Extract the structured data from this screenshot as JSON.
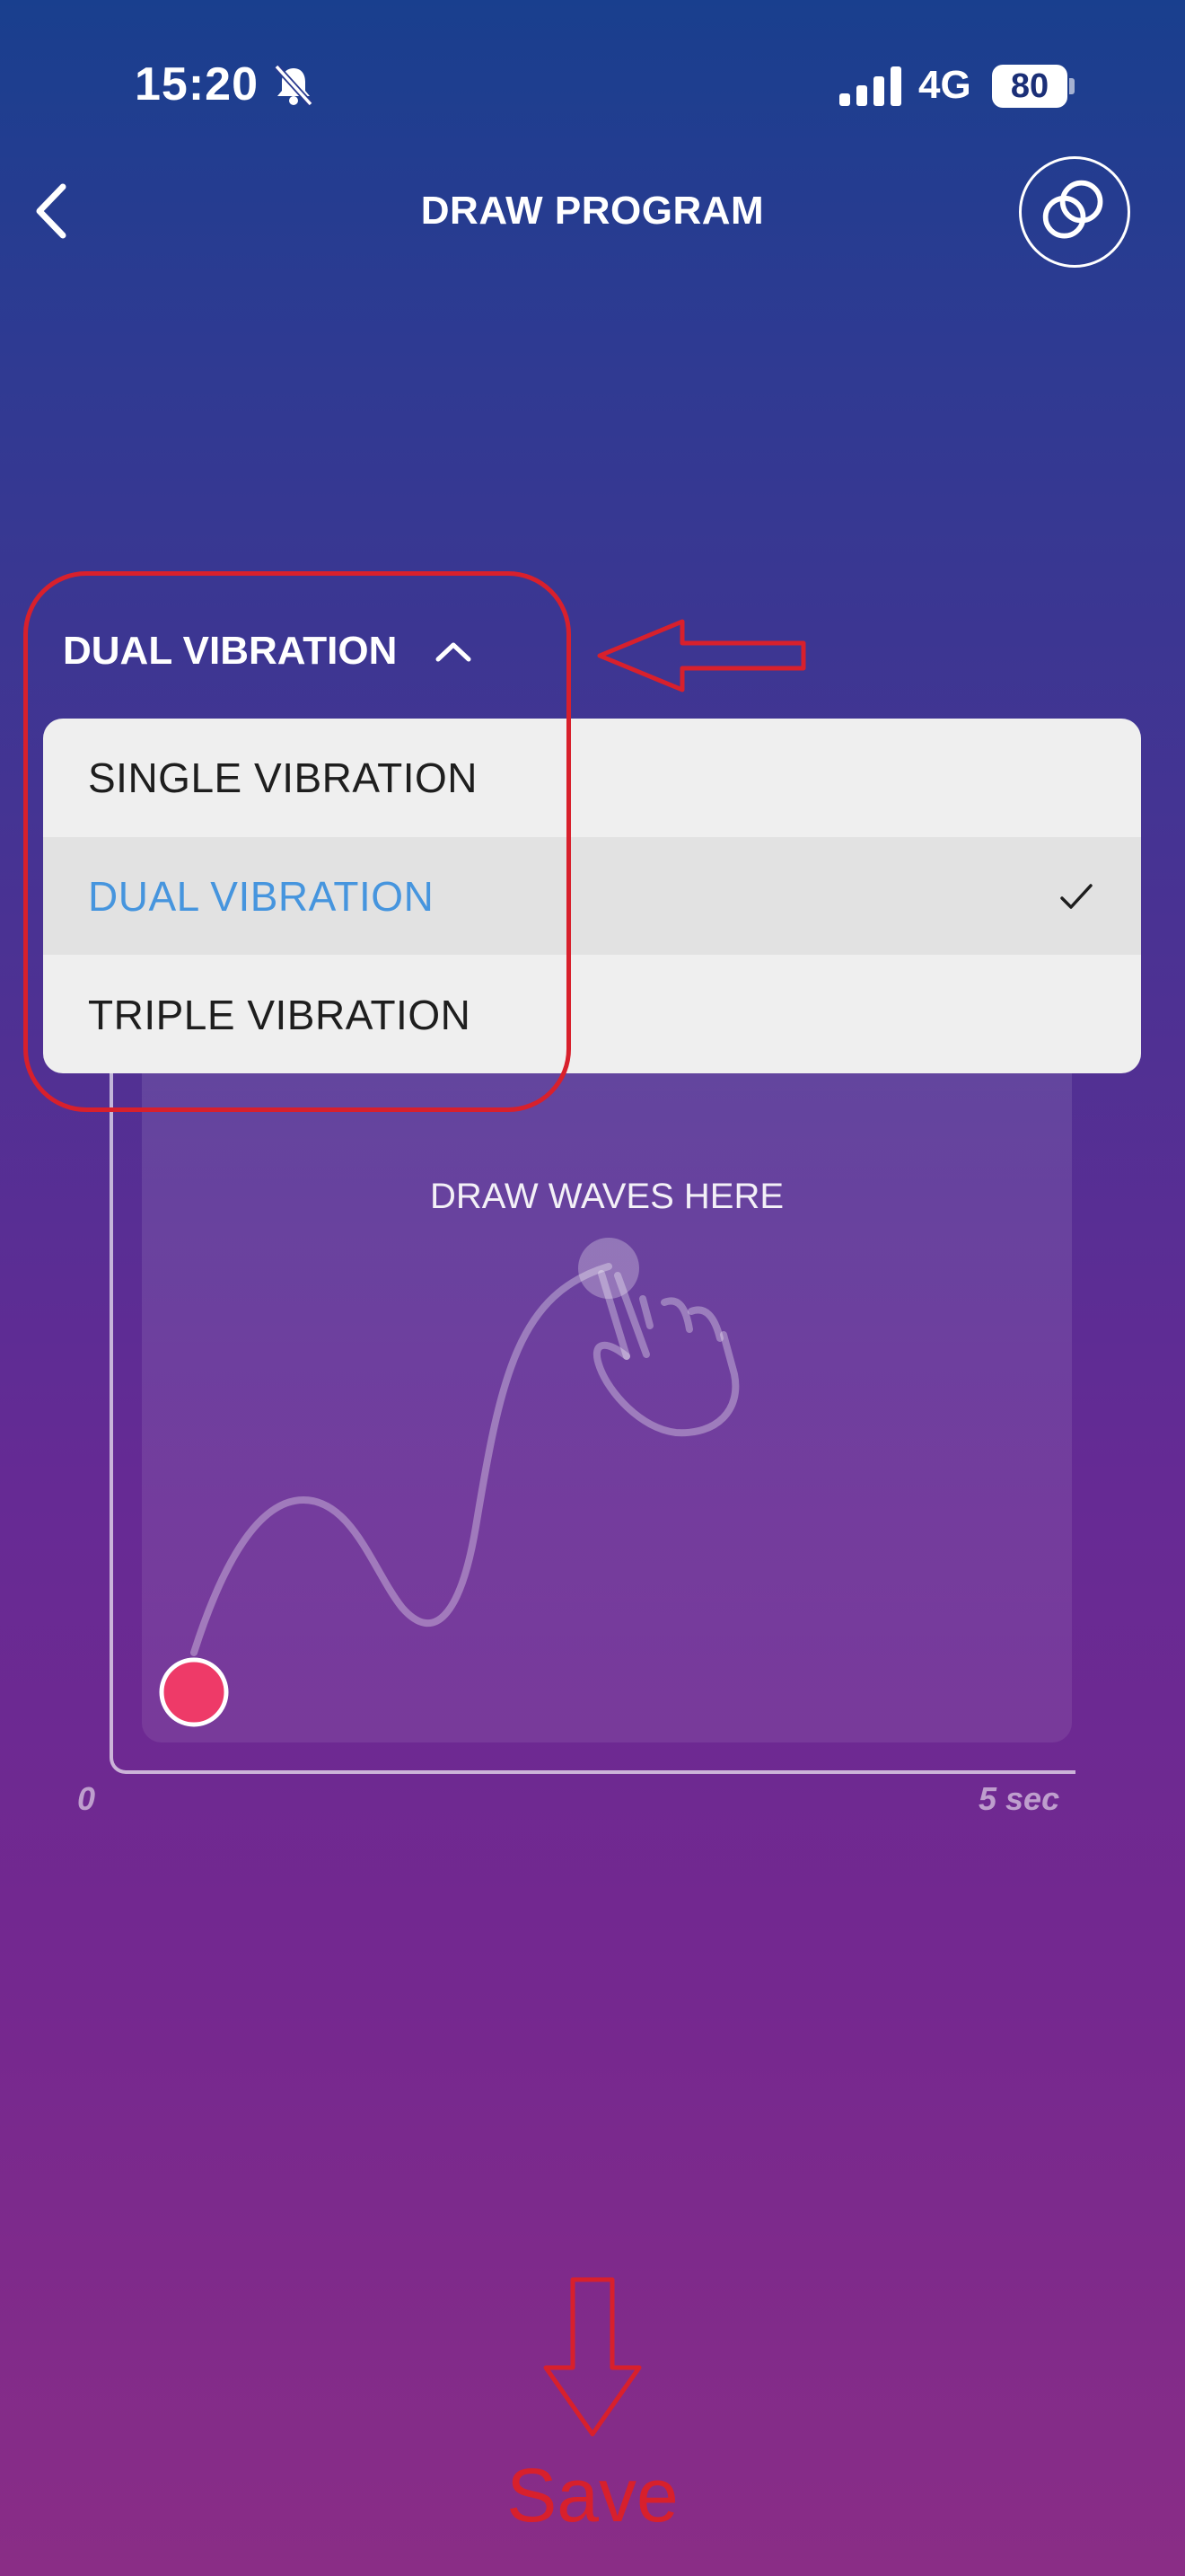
{
  "status_bar": {
    "time": "15:20",
    "network": "4G",
    "battery": "80",
    "icons": [
      "bell-slash-icon",
      "signal-icon",
      "battery-icon"
    ]
  },
  "header": {
    "title": "DRAW PROGRAM",
    "back_icon": "chevron-left-icon",
    "link_icon": "linked-rings-icon"
  },
  "mode_selector": {
    "current": "DUAL VIBRATION",
    "expanded": true,
    "options": [
      {
        "label": "SINGLE VIBRATION",
        "selected": false
      },
      {
        "label": "DUAL VIBRATION",
        "selected": true
      },
      {
        "label": "TRIPLE VIBRATION",
        "selected": false
      }
    ]
  },
  "draw_area": {
    "hint": "DRAW WAVES HERE",
    "axis_start": "0",
    "axis_end": "5 sec"
  },
  "annotations": {
    "save_label": "Save"
  },
  "colors": {
    "selected_option": "#4695de",
    "annotation_red": "#d8202c",
    "cursor_dot": "#ee3a68"
  }
}
